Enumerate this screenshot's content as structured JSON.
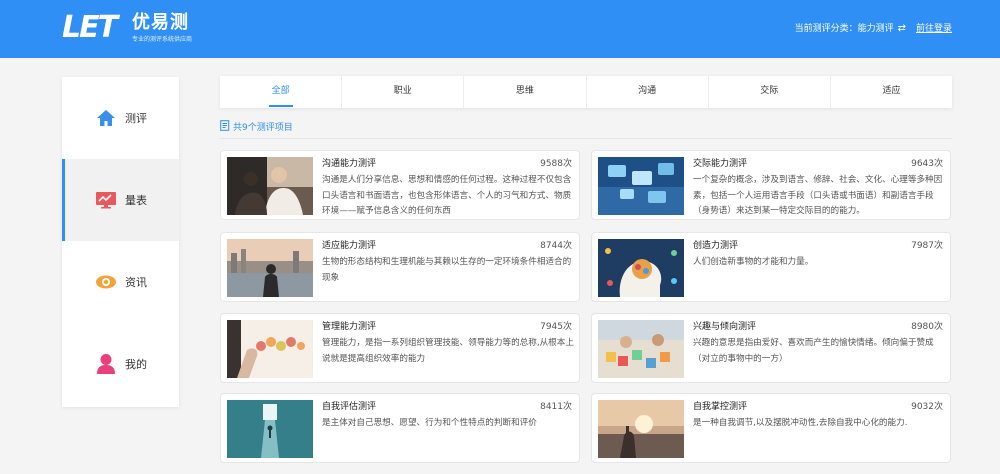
{
  "header": {
    "logo_mark": "LET",
    "logo_name": "优易测",
    "slogan": "专业的测评系统供应商",
    "category_prefix": "当前测评分类：",
    "category_value": "能力测评",
    "login": "前往登录",
    "brand_color": "#2f8ff5"
  },
  "sidebar": {
    "items": [
      {
        "label": "测评",
        "icon": "home-icon"
      },
      {
        "label": "量表",
        "icon": "chart-board-icon"
      },
      {
        "label": "资讯",
        "icon": "eye-icon"
      },
      {
        "label": "我的",
        "icon": "user-icon"
      }
    ]
  },
  "tabs": [
    "全部",
    "职业",
    "思维",
    "沟通",
    "交际",
    "适应"
  ],
  "count_text": "共9个测评项目",
  "cards": [
    {
      "title": "沟通能力测评",
      "views": "9588次",
      "desc": "沟通是人们分享信息、思想和情感的任何过程。这种过程不仅包含口头语言和书面语言，也包含形体语言、个人的习气和方式、物质环境——赋予信息含义的任何东西"
    },
    {
      "title": "交际能力测评",
      "views": "9643次",
      "desc": "一个复杂的概念，涉及到语言、修辞、社会、文化、心理等多种因素，包括一个人运用语言手段（口头语或书面语）和副语言手段（身势语）来达到某一特定交际目的的能力。"
    },
    {
      "title": "适应能力测评",
      "views": "8744次",
      "desc": "生物的形态结构和生理机能与其赖以生存的一定环境条件相适合的现象"
    },
    {
      "title": "创造力测评",
      "views": "7987次",
      "desc": "人们创造新事物的才能和力量。"
    },
    {
      "title": "管理能力测评",
      "views": "7945次",
      "desc": "管理能力，是指一系列组织管理技能、领导能力等的总称,从根本上说就是提高组织效率的能力"
    },
    {
      "title": "兴趣与倾向测评",
      "views": "8980次",
      "desc": "兴趣的意思是指由爱好、喜欢而产生的愉快情绪。倾向偏于赞成（对立的事物中的一方）"
    },
    {
      "title": "自我评估测评",
      "views": "8411次",
      "desc": "是主体对自己思想、愿望、行为和个性特点的判断和评价"
    },
    {
      "title": "自我掌控测评",
      "views": "9032次",
      "desc": "是一种自我调节,以及摆脱冲动性,去除自我中心化的能力."
    }
  ]
}
